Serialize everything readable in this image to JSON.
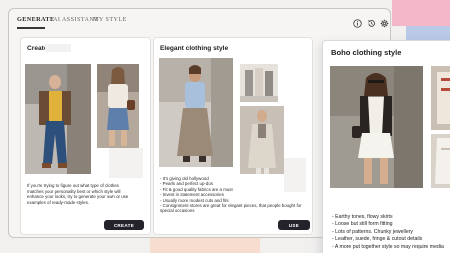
{
  "nav": {
    "tabs": [
      {
        "label": "GENERATE",
        "active": true
      },
      {
        "label": "AI ASSISTANT",
        "active": false
      },
      {
        "label": "MY STYLE",
        "active": false
      }
    ],
    "icons": [
      "info-icon",
      "history-icon",
      "settings-gear-icon"
    ]
  },
  "create_card": {
    "title": "Create style",
    "description": [
      "If you're trying to figure out what type of clothes",
      "matches your personality best or which style will",
      "enhance your looks, try to generate your own or use",
      "examples of ready-made styles."
    ],
    "button_label": "CREATE"
  },
  "elegant_card": {
    "title": "Elegant clothing style",
    "bullets": [
      "- It's giving old hollywood",
      "- Pearls and perfect up-dos",
      "- Fit & good quality fabrics are a must",
      "- Invest in statement accessories",
      "- Usually more modest cuts and fits",
      "- Consignment stores are great for elegant pieces, that people bought for",
      "  special occasions"
    ],
    "button_label": "USE"
  },
  "boho_card": {
    "title": "Boho clothing style",
    "bullets": [
      "- Earthy tones, flowy skirts",
      "- Loose but still form fitting",
      "- Lots of patterns. Chunky jewellery",
      "- Leather, suede, fringe & cutout details",
      "- A more put together style so may require media"
    ]
  },
  "colors": {
    "accent_pink": "#f4b6c9",
    "accent_blue": "#b9c9e6",
    "accent_peach": "#f6ddd0",
    "button_dark": "#24222b"
  }
}
